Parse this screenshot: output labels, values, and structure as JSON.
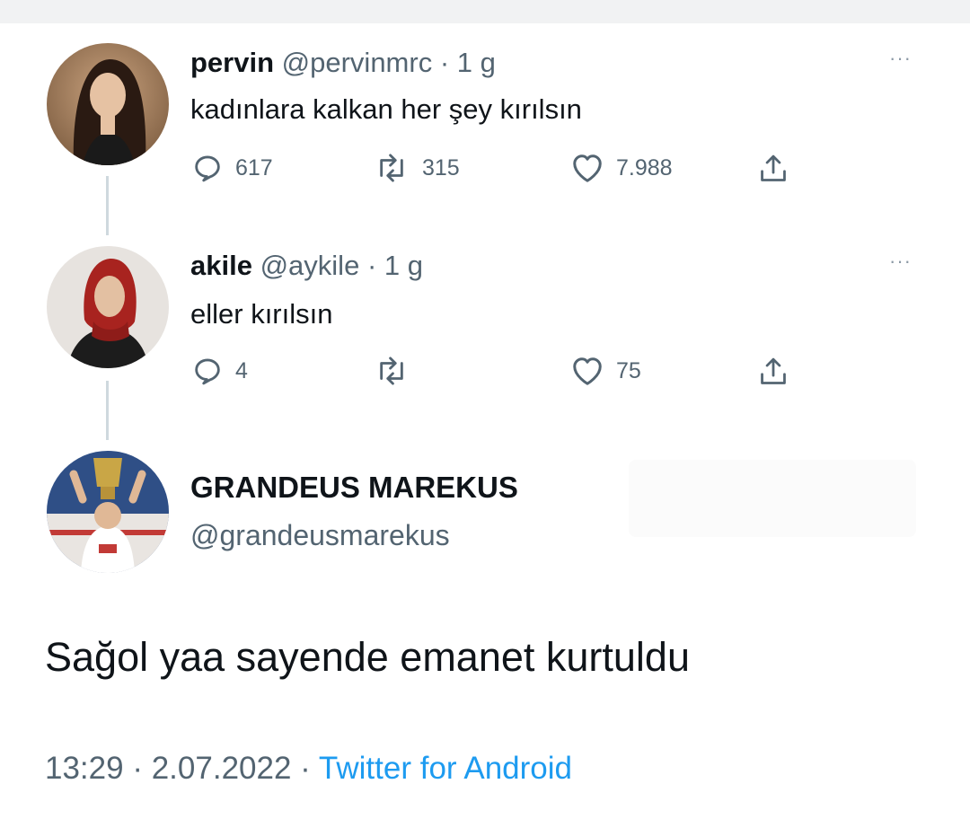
{
  "tweets": [
    {
      "name": "pervin",
      "handle": "@pervinmrc",
      "separator": "·",
      "time": "1 g",
      "text": "kadınlara kalkan her şey kırılsın",
      "more": "···",
      "replies": "617",
      "retweets": "315",
      "likes": "7.988"
    },
    {
      "name": "akile",
      "handle": "@aykile",
      "separator": "·",
      "time": "1 g",
      "text": "eller kırılsın",
      "more": "···",
      "replies": "4",
      "retweets": "",
      "likes": "75"
    }
  ],
  "main_tweet": {
    "name": "GRANDEUS MAREKUS",
    "handle": "@grandeusmarekus",
    "text": "Sağol yaa sayende emanet kurtuldu",
    "time": "13:29",
    "separator": "·",
    "date": "2.07.2022",
    "separator2": "·",
    "source": "Twitter for Android"
  },
  "icons": {
    "reply": "reply-icon",
    "retweet": "retweet-icon",
    "like": "heart-icon",
    "share": "share-icon",
    "more": "more-icon"
  },
  "colors": {
    "text": "#0f1419",
    "secondary": "#536471",
    "link": "#1d9bf0",
    "thread_line": "#cfd9de"
  }
}
